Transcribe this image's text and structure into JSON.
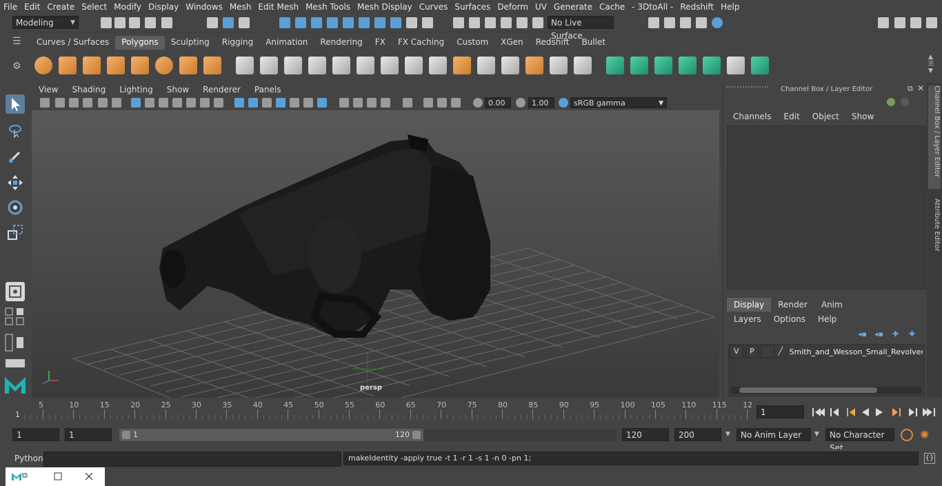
{
  "menubar": {
    "items": [
      "File",
      "Edit",
      "Create",
      "Select",
      "Modify",
      "Display",
      "Windows",
      "Mesh",
      "Edit Mesh",
      "Mesh Tools",
      "Mesh Display",
      "Curves",
      "Surfaces",
      "Deform",
      "UV",
      "Generate",
      "Cache",
      "- 3DtoAll -",
      "Redshift",
      "Help"
    ]
  },
  "status": {
    "workspace": "Modeling",
    "live_surface": "No Live Surface"
  },
  "shelf": {
    "tabs": [
      "Curves / Surfaces",
      "Polygons",
      "Sculpting",
      "Rigging",
      "Animation",
      "Rendering",
      "FX",
      "FX Caching",
      "Custom",
      "XGen",
      "Redshift",
      "Bullet"
    ],
    "active_tab": "Polygons"
  },
  "viewport": {
    "menu": [
      "View",
      "Shading",
      "Lighting",
      "Show",
      "Renderer",
      "Panels"
    ],
    "exposure": "0.00",
    "gamma": "1.00",
    "color_space": "sRGB gamma",
    "camera_label": "persp"
  },
  "channel_box": {
    "title": "Channel Box / Layer Editor",
    "menu": [
      "Channels",
      "Edit",
      "Object",
      "Show"
    ]
  },
  "layer_editor": {
    "tabs": [
      "Display",
      "Render",
      "Anim"
    ],
    "active_tab": "Display",
    "menu": [
      "Layers",
      "Options",
      "Help"
    ],
    "layer": {
      "visible": "V",
      "playback": "P",
      "name": "Smith_and_Wesson_Small_Revolver_Bl"
    }
  },
  "side_tabs": [
    "Channel Box / Layer Editor",
    "Attribute Editor"
  ],
  "timeline": {
    "ticks": [
      "5",
      "10",
      "15",
      "20",
      "25",
      "30",
      "35",
      "40",
      "45",
      "50",
      "55",
      "60",
      "65",
      "70",
      "75",
      "80",
      "85",
      "90",
      "95",
      "100",
      "105",
      "110",
      "115",
      "12"
    ],
    "start_label": "1",
    "current_frame": "1"
  },
  "range": {
    "start": "1",
    "playback_start": "1",
    "range_start_label": "1",
    "range_end_label": "120",
    "playback_end": "120",
    "end": "200",
    "anim_layer": "No Anim Layer",
    "character_set": "No Character Set"
  },
  "command": {
    "language": "Python",
    "result": "makeIdentity -apply true -t 1 -r 1 -s 1 -n 0 -pn 1;"
  },
  "colors": {
    "background": "#444444",
    "accent": "#5aa0d8",
    "shelf_icon": "#f6b26b"
  }
}
